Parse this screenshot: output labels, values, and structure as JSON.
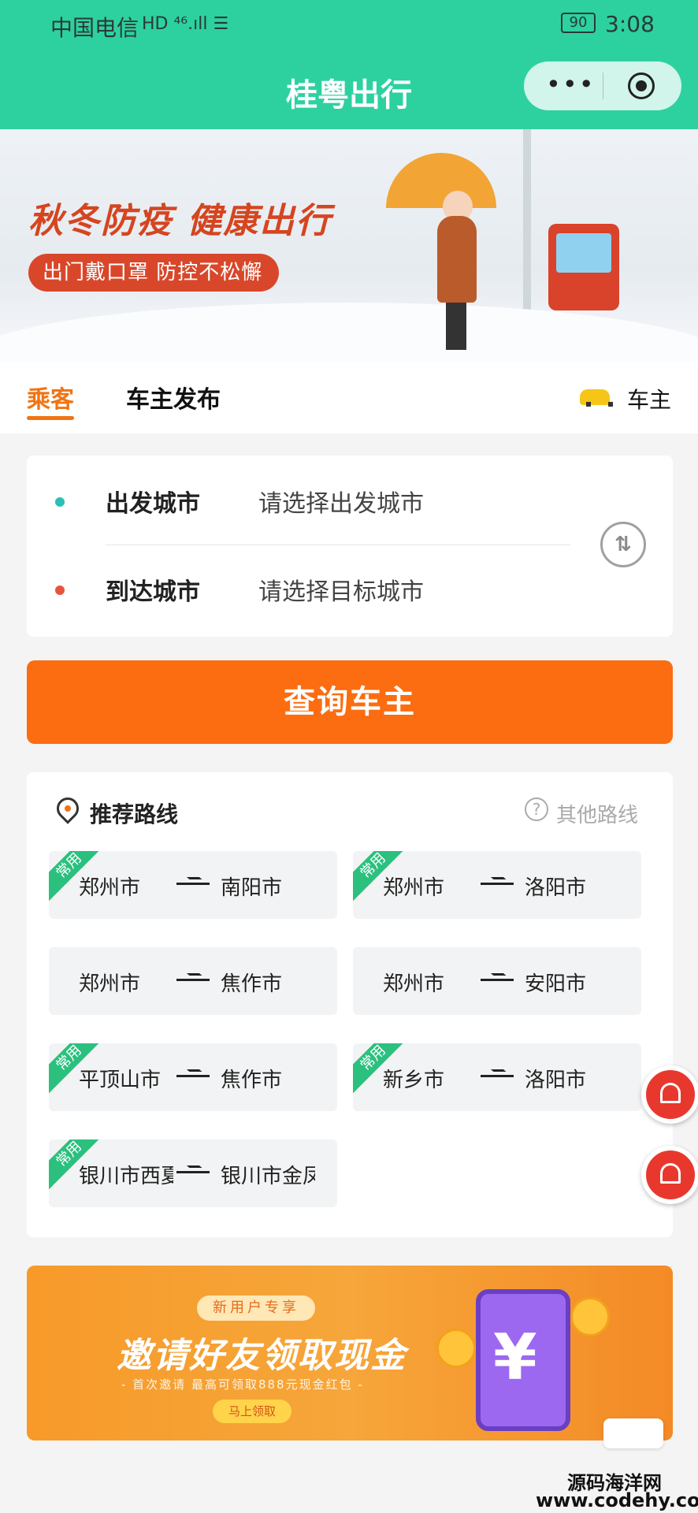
{
  "status_bar": {
    "carrier": "中国电信",
    "signal": "HD ⁴⁶.ıll ☰",
    "battery": "90",
    "time": "3:08"
  },
  "nav": {
    "title": "桂粤出行"
  },
  "banner": {
    "title": "秋冬防疫 健康出行",
    "subtitle": "出门戴口罩 防控不松懈"
  },
  "tabs": {
    "passenger": "乘客",
    "publish": "车主发布",
    "driver": "车主"
  },
  "city_form": {
    "depart_label": "出发城市",
    "depart_placeholder": "请选择出发城市",
    "arrive_label": "到达城市",
    "arrive_placeholder": "请选择目标城市"
  },
  "query_button": "查询车主",
  "routes": {
    "title": "推荐路线",
    "other": "其他路线",
    "tag": "常用",
    "items": [
      {
        "from": "郑州市",
        "to": "南阳市",
        "common": true
      },
      {
        "from": "郑州市",
        "to": "洛阳市",
        "common": true
      },
      {
        "from": "郑州市",
        "to": "焦作市",
        "common": false
      },
      {
        "from": "郑州市",
        "to": "安阳市",
        "common": false
      },
      {
        "from": "平顶山市",
        "to": "焦作市",
        "common": true
      },
      {
        "from": "新乡市",
        "to": "洛阳市",
        "common": true
      },
      {
        "from": "银川市西夏区",
        "to": "银川市金凤区",
        "common": true
      }
    ]
  },
  "promo": {
    "badge": "新用户专享",
    "headline": "邀请好友领取现金",
    "sub": "- 首次邀请 最高可领取888元现金红包 -",
    "cta": "马上领取"
  },
  "watermark": {
    "line1": "源码海洋网",
    "line2": "www.codehy.com"
  }
}
